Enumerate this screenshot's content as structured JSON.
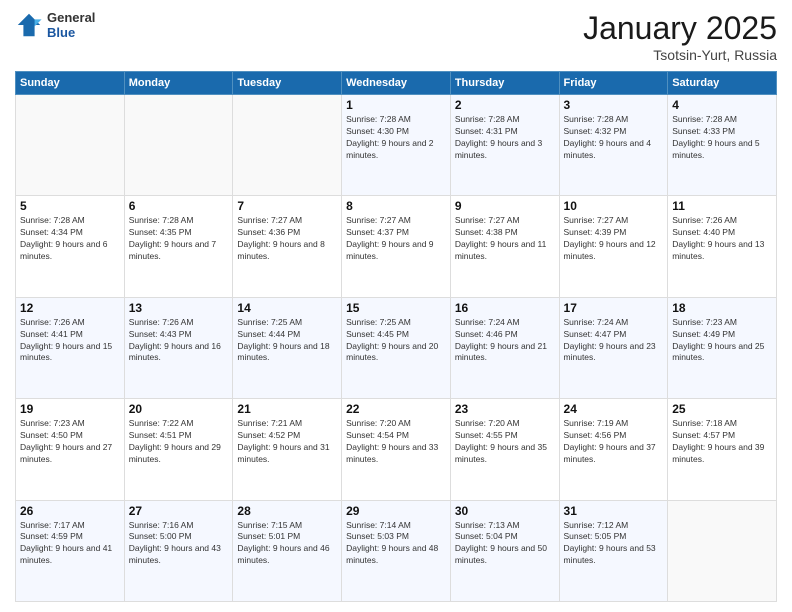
{
  "logo": {
    "general": "General",
    "blue": "Blue"
  },
  "header": {
    "month": "January 2025",
    "location": "Tsotsin-Yurt, Russia"
  },
  "weekdays": [
    "Sunday",
    "Monday",
    "Tuesday",
    "Wednesday",
    "Thursday",
    "Friday",
    "Saturday"
  ],
  "weeks": [
    [
      {
        "day": "",
        "sunrise": "",
        "sunset": "",
        "daylight": ""
      },
      {
        "day": "",
        "sunrise": "",
        "sunset": "",
        "daylight": ""
      },
      {
        "day": "",
        "sunrise": "",
        "sunset": "",
        "daylight": ""
      },
      {
        "day": "1",
        "sunrise": "Sunrise: 7:28 AM",
        "sunset": "Sunset: 4:30 PM",
        "daylight": "Daylight: 9 hours and 2 minutes."
      },
      {
        "day": "2",
        "sunrise": "Sunrise: 7:28 AM",
        "sunset": "Sunset: 4:31 PM",
        "daylight": "Daylight: 9 hours and 3 minutes."
      },
      {
        "day": "3",
        "sunrise": "Sunrise: 7:28 AM",
        "sunset": "Sunset: 4:32 PM",
        "daylight": "Daylight: 9 hours and 4 minutes."
      },
      {
        "day": "4",
        "sunrise": "Sunrise: 7:28 AM",
        "sunset": "Sunset: 4:33 PM",
        "daylight": "Daylight: 9 hours and 5 minutes."
      }
    ],
    [
      {
        "day": "5",
        "sunrise": "Sunrise: 7:28 AM",
        "sunset": "Sunset: 4:34 PM",
        "daylight": "Daylight: 9 hours and 6 minutes."
      },
      {
        "day": "6",
        "sunrise": "Sunrise: 7:28 AM",
        "sunset": "Sunset: 4:35 PM",
        "daylight": "Daylight: 9 hours and 7 minutes."
      },
      {
        "day": "7",
        "sunrise": "Sunrise: 7:27 AM",
        "sunset": "Sunset: 4:36 PM",
        "daylight": "Daylight: 9 hours and 8 minutes."
      },
      {
        "day": "8",
        "sunrise": "Sunrise: 7:27 AM",
        "sunset": "Sunset: 4:37 PM",
        "daylight": "Daylight: 9 hours and 9 minutes."
      },
      {
        "day": "9",
        "sunrise": "Sunrise: 7:27 AM",
        "sunset": "Sunset: 4:38 PM",
        "daylight": "Daylight: 9 hours and 11 minutes."
      },
      {
        "day": "10",
        "sunrise": "Sunrise: 7:27 AM",
        "sunset": "Sunset: 4:39 PM",
        "daylight": "Daylight: 9 hours and 12 minutes."
      },
      {
        "day": "11",
        "sunrise": "Sunrise: 7:26 AM",
        "sunset": "Sunset: 4:40 PM",
        "daylight": "Daylight: 9 hours and 13 minutes."
      }
    ],
    [
      {
        "day": "12",
        "sunrise": "Sunrise: 7:26 AM",
        "sunset": "Sunset: 4:41 PM",
        "daylight": "Daylight: 9 hours and 15 minutes."
      },
      {
        "day": "13",
        "sunrise": "Sunrise: 7:26 AM",
        "sunset": "Sunset: 4:43 PM",
        "daylight": "Daylight: 9 hours and 16 minutes."
      },
      {
        "day": "14",
        "sunrise": "Sunrise: 7:25 AM",
        "sunset": "Sunset: 4:44 PM",
        "daylight": "Daylight: 9 hours and 18 minutes."
      },
      {
        "day": "15",
        "sunrise": "Sunrise: 7:25 AM",
        "sunset": "Sunset: 4:45 PM",
        "daylight": "Daylight: 9 hours and 20 minutes."
      },
      {
        "day": "16",
        "sunrise": "Sunrise: 7:24 AM",
        "sunset": "Sunset: 4:46 PM",
        "daylight": "Daylight: 9 hours and 21 minutes."
      },
      {
        "day": "17",
        "sunrise": "Sunrise: 7:24 AM",
        "sunset": "Sunset: 4:47 PM",
        "daylight": "Daylight: 9 hours and 23 minutes."
      },
      {
        "day": "18",
        "sunrise": "Sunrise: 7:23 AM",
        "sunset": "Sunset: 4:49 PM",
        "daylight": "Daylight: 9 hours and 25 minutes."
      }
    ],
    [
      {
        "day": "19",
        "sunrise": "Sunrise: 7:23 AM",
        "sunset": "Sunset: 4:50 PM",
        "daylight": "Daylight: 9 hours and 27 minutes."
      },
      {
        "day": "20",
        "sunrise": "Sunrise: 7:22 AM",
        "sunset": "Sunset: 4:51 PM",
        "daylight": "Daylight: 9 hours and 29 minutes."
      },
      {
        "day": "21",
        "sunrise": "Sunrise: 7:21 AM",
        "sunset": "Sunset: 4:52 PM",
        "daylight": "Daylight: 9 hours and 31 minutes."
      },
      {
        "day": "22",
        "sunrise": "Sunrise: 7:20 AM",
        "sunset": "Sunset: 4:54 PM",
        "daylight": "Daylight: 9 hours and 33 minutes."
      },
      {
        "day": "23",
        "sunrise": "Sunrise: 7:20 AM",
        "sunset": "Sunset: 4:55 PM",
        "daylight": "Daylight: 9 hours and 35 minutes."
      },
      {
        "day": "24",
        "sunrise": "Sunrise: 7:19 AM",
        "sunset": "Sunset: 4:56 PM",
        "daylight": "Daylight: 9 hours and 37 minutes."
      },
      {
        "day": "25",
        "sunrise": "Sunrise: 7:18 AM",
        "sunset": "Sunset: 4:57 PM",
        "daylight": "Daylight: 9 hours and 39 minutes."
      }
    ],
    [
      {
        "day": "26",
        "sunrise": "Sunrise: 7:17 AM",
        "sunset": "Sunset: 4:59 PM",
        "daylight": "Daylight: 9 hours and 41 minutes."
      },
      {
        "day": "27",
        "sunrise": "Sunrise: 7:16 AM",
        "sunset": "Sunset: 5:00 PM",
        "daylight": "Daylight: 9 hours and 43 minutes."
      },
      {
        "day": "28",
        "sunrise": "Sunrise: 7:15 AM",
        "sunset": "Sunset: 5:01 PM",
        "daylight": "Daylight: 9 hours and 46 minutes."
      },
      {
        "day": "29",
        "sunrise": "Sunrise: 7:14 AM",
        "sunset": "Sunset: 5:03 PM",
        "daylight": "Daylight: 9 hours and 48 minutes."
      },
      {
        "day": "30",
        "sunrise": "Sunrise: 7:13 AM",
        "sunset": "Sunset: 5:04 PM",
        "daylight": "Daylight: 9 hours and 50 minutes."
      },
      {
        "day": "31",
        "sunrise": "Sunrise: 7:12 AM",
        "sunset": "Sunset: 5:05 PM",
        "daylight": "Daylight: 9 hours and 53 minutes."
      },
      {
        "day": "",
        "sunrise": "",
        "sunset": "",
        "daylight": ""
      }
    ]
  ]
}
